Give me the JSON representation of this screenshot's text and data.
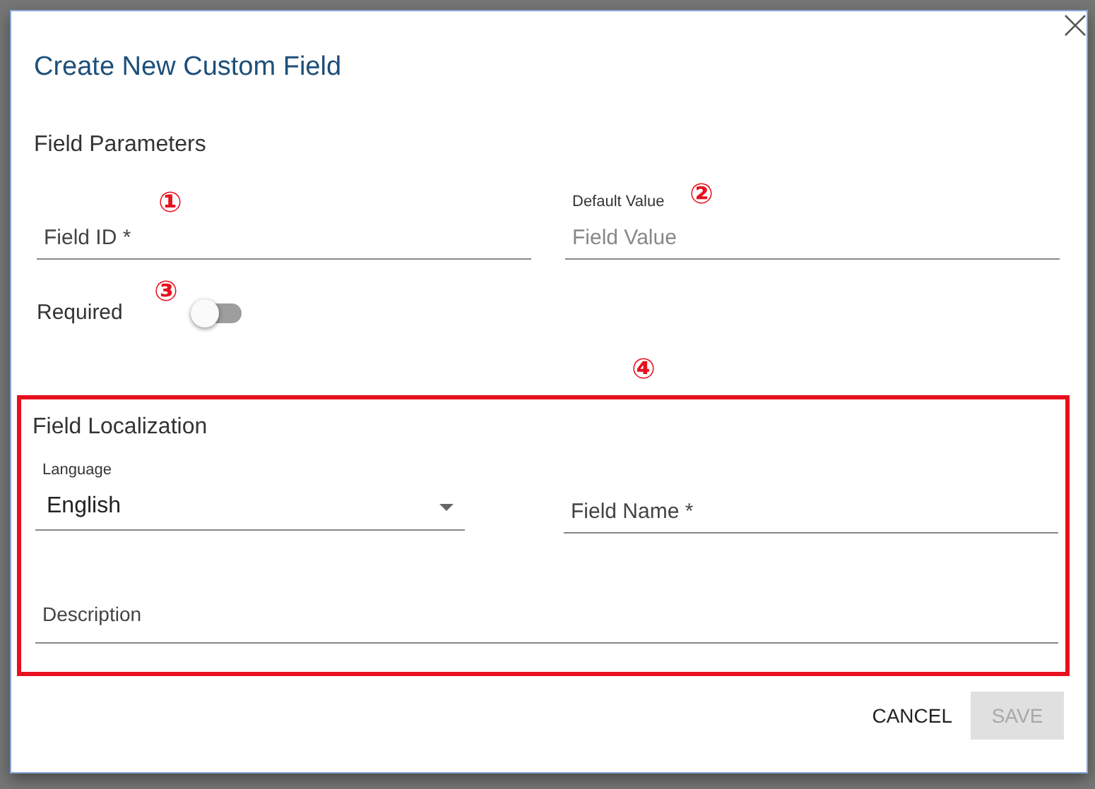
{
  "dialog": {
    "title": "Create New Custom Field"
  },
  "parameters": {
    "title": "Field Parameters",
    "field_id": {
      "placeholder": "Field ID *"
    },
    "default_value": {
      "label": "Default Value",
      "placeholder": "Field Value"
    },
    "required": {
      "label": "Required",
      "on": false
    }
  },
  "localization": {
    "title": "Field Localization",
    "language": {
      "label": "Language",
      "value": "English"
    },
    "field_name": {
      "placeholder": "Field Name *"
    },
    "description": {
      "placeholder": "Description"
    }
  },
  "buttons": [
    {
      "label": "CANCEL",
      "kind": "text",
      "disabled": false
    },
    {
      "label": "SAVE",
      "kind": "contained",
      "disabled": true
    }
  ],
  "annotations": [
    "①",
    "②",
    "③",
    "④"
  ]
}
